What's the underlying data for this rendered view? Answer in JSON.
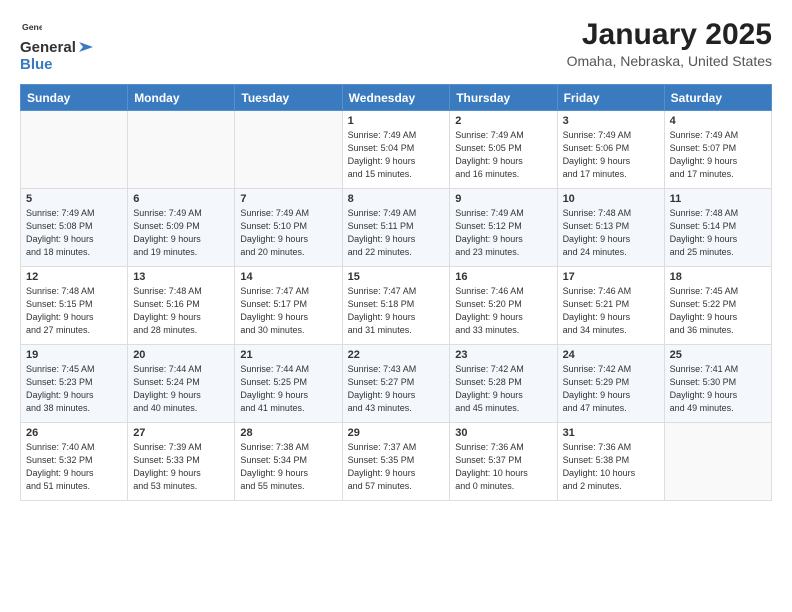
{
  "header": {
    "logo_general": "General",
    "logo_blue": "Blue",
    "month_title": "January 2025",
    "location": "Omaha, Nebraska, United States"
  },
  "weekdays": [
    "Sunday",
    "Monday",
    "Tuesday",
    "Wednesday",
    "Thursday",
    "Friday",
    "Saturday"
  ],
  "weeks": [
    [
      {
        "day": "",
        "info": ""
      },
      {
        "day": "",
        "info": ""
      },
      {
        "day": "",
        "info": ""
      },
      {
        "day": "1",
        "info": "Sunrise: 7:49 AM\nSunset: 5:04 PM\nDaylight: 9 hours\nand 15 minutes."
      },
      {
        "day": "2",
        "info": "Sunrise: 7:49 AM\nSunset: 5:05 PM\nDaylight: 9 hours\nand 16 minutes."
      },
      {
        "day": "3",
        "info": "Sunrise: 7:49 AM\nSunset: 5:06 PM\nDaylight: 9 hours\nand 17 minutes."
      },
      {
        "day": "4",
        "info": "Sunrise: 7:49 AM\nSunset: 5:07 PM\nDaylight: 9 hours\nand 17 minutes."
      }
    ],
    [
      {
        "day": "5",
        "info": "Sunrise: 7:49 AM\nSunset: 5:08 PM\nDaylight: 9 hours\nand 18 minutes."
      },
      {
        "day": "6",
        "info": "Sunrise: 7:49 AM\nSunset: 5:09 PM\nDaylight: 9 hours\nand 19 minutes."
      },
      {
        "day": "7",
        "info": "Sunrise: 7:49 AM\nSunset: 5:10 PM\nDaylight: 9 hours\nand 20 minutes."
      },
      {
        "day": "8",
        "info": "Sunrise: 7:49 AM\nSunset: 5:11 PM\nDaylight: 9 hours\nand 22 minutes."
      },
      {
        "day": "9",
        "info": "Sunrise: 7:49 AM\nSunset: 5:12 PM\nDaylight: 9 hours\nand 23 minutes."
      },
      {
        "day": "10",
        "info": "Sunrise: 7:48 AM\nSunset: 5:13 PM\nDaylight: 9 hours\nand 24 minutes."
      },
      {
        "day": "11",
        "info": "Sunrise: 7:48 AM\nSunset: 5:14 PM\nDaylight: 9 hours\nand 25 minutes."
      }
    ],
    [
      {
        "day": "12",
        "info": "Sunrise: 7:48 AM\nSunset: 5:15 PM\nDaylight: 9 hours\nand 27 minutes."
      },
      {
        "day": "13",
        "info": "Sunrise: 7:48 AM\nSunset: 5:16 PM\nDaylight: 9 hours\nand 28 minutes."
      },
      {
        "day": "14",
        "info": "Sunrise: 7:47 AM\nSunset: 5:17 PM\nDaylight: 9 hours\nand 30 minutes."
      },
      {
        "day": "15",
        "info": "Sunrise: 7:47 AM\nSunset: 5:18 PM\nDaylight: 9 hours\nand 31 minutes."
      },
      {
        "day": "16",
        "info": "Sunrise: 7:46 AM\nSunset: 5:20 PM\nDaylight: 9 hours\nand 33 minutes."
      },
      {
        "day": "17",
        "info": "Sunrise: 7:46 AM\nSunset: 5:21 PM\nDaylight: 9 hours\nand 34 minutes."
      },
      {
        "day": "18",
        "info": "Sunrise: 7:45 AM\nSunset: 5:22 PM\nDaylight: 9 hours\nand 36 minutes."
      }
    ],
    [
      {
        "day": "19",
        "info": "Sunrise: 7:45 AM\nSunset: 5:23 PM\nDaylight: 9 hours\nand 38 minutes."
      },
      {
        "day": "20",
        "info": "Sunrise: 7:44 AM\nSunset: 5:24 PM\nDaylight: 9 hours\nand 40 minutes."
      },
      {
        "day": "21",
        "info": "Sunrise: 7:44 AM\nSunset: 5:25 PM\nDaylight: 9 hours\nand 41 minutes."
      },
      {
        "day": "22",
        "info": "Sunrise: 7:43 AM\nSunset: 5:27 PM\nDaylight: 9 hours\nand 43 minutes."
      },
      {
        "day": "23",
        "info": "Sunrise: 7:42 AM\nSunset: 5:28 PM\nDaylight: 9 hours\nand 45 minutes."
      },
      {
        "day": "24",
        "info": "Sunrise: 7:42 AM\nSunset: 5:29 PM\nDaylight: 9 hours\nand 47 minutes."
      },
      {
        "day": "25",
        "info": "Sunrise: 7:41 AM\nSunset: 5:30 PM\nDaylight: 9 hours\nand 49 minutes."
      }
    ],
    [
      {
        "day": "26",
        "info": "Sunrise: 7:40 AM\nSunset: 5:32 PM\nDaylight: 9 hours\nand 51 minutes."
      },
      {
        "day": "27",
        "info": "Sunrise: 7:39 AM\nSunset: 5:33 PM\nDaylight: 9 hours\nand 53 minutes."
      },
      {
        "day": "28",
        "info": "Sunrise: 7:38 AM\nSunset: 5:34 PM\nDaylight: 9 hours\nand 55 minutes."
      },
      {
        "day": "29",
        "info": "Sunrise: 7:37 AM\nSunset: 5:35 PM\nDaylight: 9 hours\nand 57 minutes."
      },
      {
        "day": "30",
        "info": "Sunrise: 7:36 AM\nSunset: 5:37 PM\nDaylight: 10 hours\nand 0 minutes."
      },
      {
        "day": "31",
        "info": "Sunrise: 7:36 AM\nSunset: 5:38 PM\nDaylight: 10 hours\nand 2 minutes."
      },
      {
        "day": "",
        "info": ""
      }
    ]
  ]
}
